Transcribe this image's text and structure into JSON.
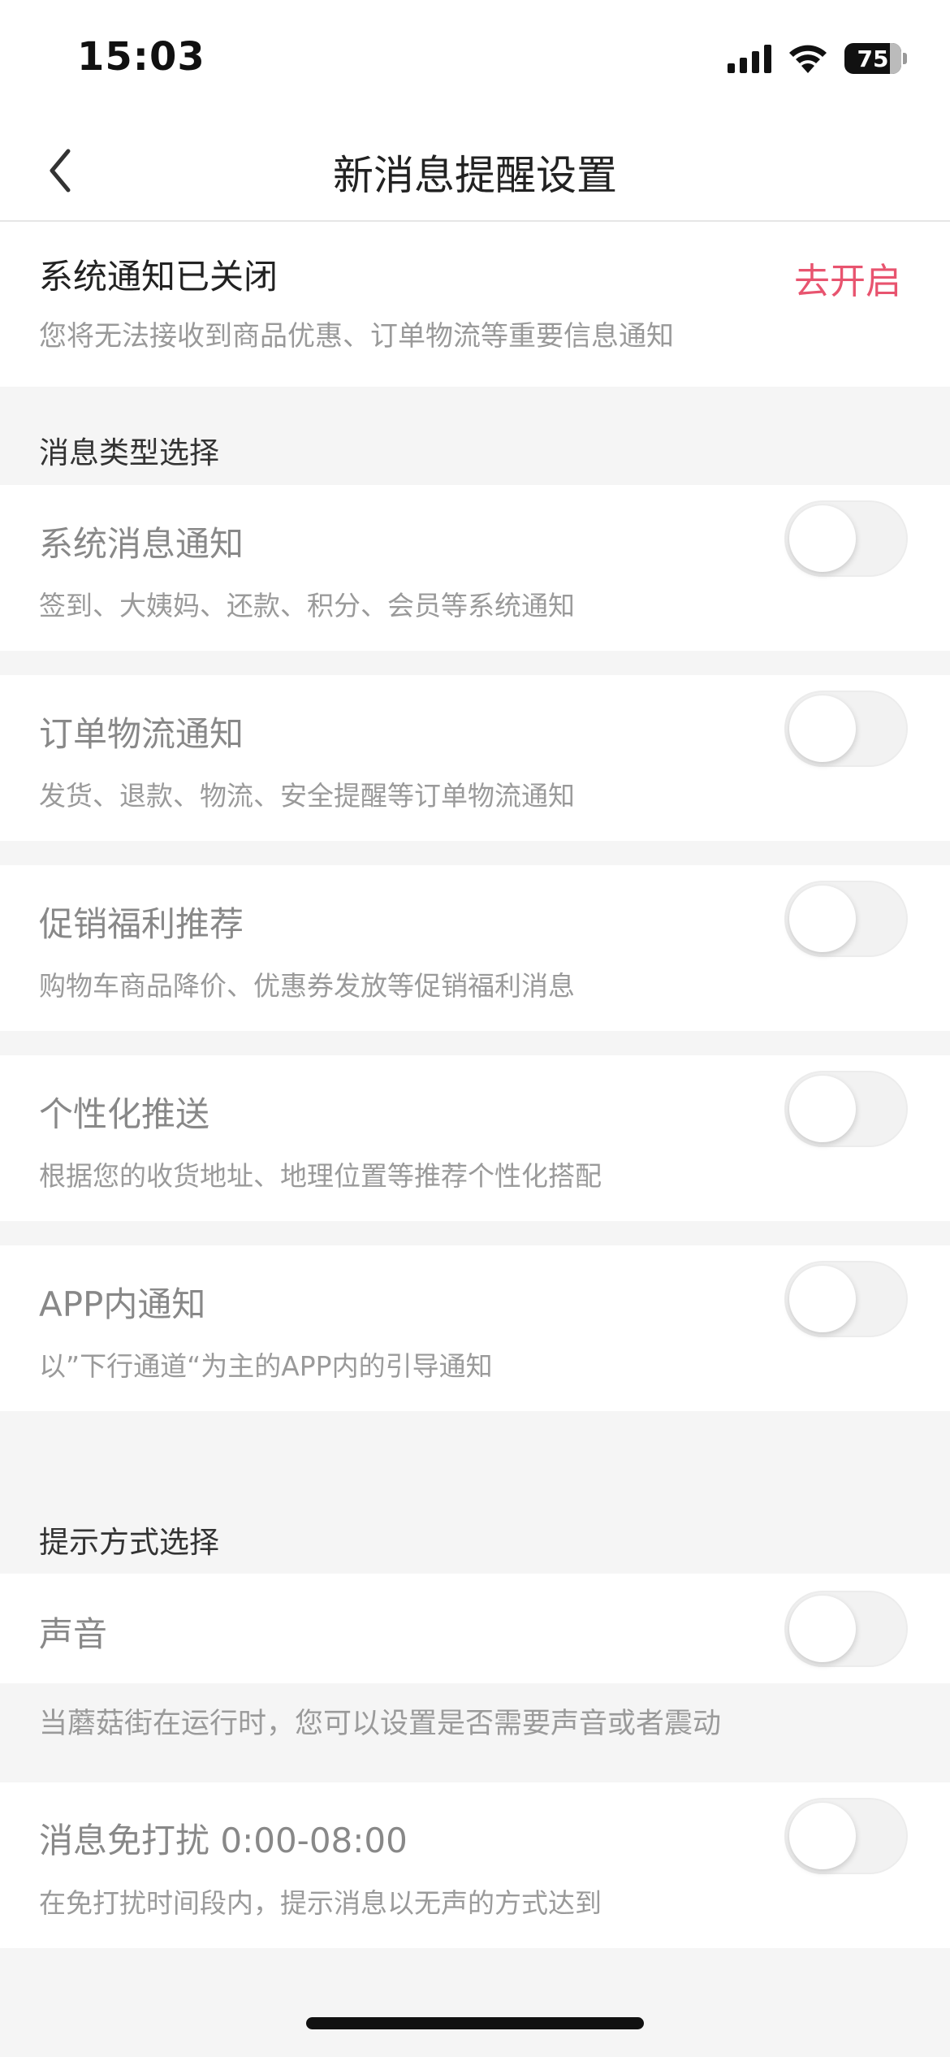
{
  "status_bar": {
    "time": "15:03",
    "battery": "75"
  },
  "nav": {
    "title": "新消息提醒设置"
  },
  "system_notice": {
    "title": "系统通知已关闭",
    "subtitle": "您将无法接收到商品优惠、订单物流等重要信息通知",
    "action": "去开启",
    "action_color": "#e8546f"
  },
  "message_types": {
    "header": "消息类型选择",
    "items": [
      {
        "title": "系统消息通知",
        "subtitle": "签到、大姨妈、还款、积分、会员等系统通知",
        "enabled": false
      },
      {
        "title": "订单物流通知",
        "subtitle": "发货、退款、物流、安全提醒等订单物流通知",
        "enabled": false
      },
      {
        "title": "促销福利推荐",
        "subtitle": "购物车商品降价、优惠券发放等促销福利消息",
        "enabled": false
      },
      {
        "title": "个性化推送",
        "subtitle": "根据您的收货地址、地理位置等推荐个性化搭配",
        "enabled": false
      },
      {
        "title": "APP内通知",
        "subtitle": "以”下行通道“为主的APP内的引导通知",
        "enabled": false
      }
    ]
  },
  "alert_methods": {
    "header": "提示方式选择",
    "sound": {
      "title": "声音",
      "enabled": false
    },
    "sound_note": "当蘑菇街在运行时，您可以设置是否需要声音或者震动",
    "dnd": {
      "title": "消息免打扰 0:00-08:00",
      "subtitle": "在免打扰时间段内，提示消息以无声的方式达到",
      "enabled": false
    }
  },
  "icons": [
    "back-chevron-icon",
    "cellular-signal-icon",
    "wifi-icon",
    "battery-icon"
  ]
}
